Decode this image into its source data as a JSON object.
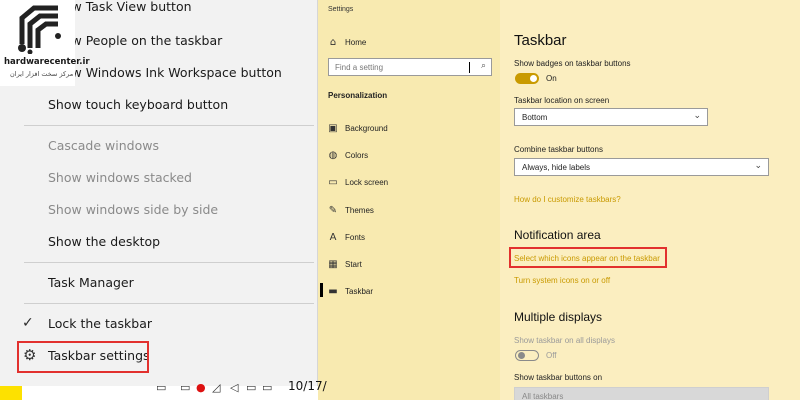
{
  "context_menu": {
    "items": [
      {
        "label": "Show Task View button",
        "checked": true,
        "disabled": false
      },
      {
        "label": "Show People on the taskbar",
        "checked": false,
        "disabled": false
      },
      {
        "label": "Show Windows Ink Workspace button",
        "checked": false,
        "disabled": false
      },
      {
        "label": "Show touch keyboard button",
        "checked": false,
        "disabled": false
      },
      {
        "label": "Cascade windows",
        "disabled": true
      },
      {
        "label": "Show windows stacked",
        "disabled": true
      },
      {
        "label": "Show windows side by side",
        "disabled": true
      },
      {
        "label": "Show the desktop",
        "disabled": false
      },
      {
        "label": "Task Manager",
        "disabled": false
      },
      {
        "label": "Lock the taskbar",
        "checked": true,
        "disabled": false
      },
      {
        "label": "Taskbar settings",
        "icon": "gear-icon",
        "disabled": false
      }
    ],
    "check_glyph": "✓",
    "gear_glyph": "⚙"
  },
  "taskbar": {
    "clock_partial": "10/17/"
  },
  "logo": {
    "name": "hardwarecenter.ir",
    "subtitle": "مرکز سخت افزار ایران"
  },
  "settings_nav": {
    "window_title": "Settings",
    "home_label": "Home",
    "search_placeholder": "Find a setting",
    "section": "Personalization",
    "items": [
      {
        "label": "Background",
        "icon": "picture-icon"
      },
      {
        "label": "Colors",
        "icon": "palette-icon"
      },
      {
        "label": "Lock screen",
        "icon": "monitor-icon"
      },
      {
        "label": "Themes",
        "icon": "brush-icon"
      },
      {
        "label": "Fonts",
        "icon": "font-icon"
      },
      {
        "label": "Start",
        "icon": "start-icon"
      },
      {
        "label": "Taskbar",
        "icon": "taskbar-icon",
        "active": true
      }
    ]
  },
  "taskbar_page": {
    "title": "Taskbar",
    "badges_label": "Show badges on taskbar buttons",
    "badges_state": "On",
    "location_label": "Taskbar location on screen",
    "location_value": "Bottom",
    "combine_label": "Combine taskbar buttons",
    "combine_value": "Always, hide labels",
    "customize_link": "How do I customize taskbars?",
    "notification_heading": "Notification area",
    "select_icons_link": "Select which icons appear on the taskbar",
    "system_icons_link": "Turn system icons on or off",
    "multiple_displays_heading": "Multiple displays",
    "show_all_displays_label": "Show taskbar on all displays",
    "show_all_displays_state": "Off",
    "show_buttons_on_label": "Show taskbar buttons on",
    "show_buttons_on_value": "All taskbars"
  },
  "colors": {
    "accent": "#c99a00",
    "highlight_box": "#e2312e",
    "yellow": "#fde100"
  }
}
